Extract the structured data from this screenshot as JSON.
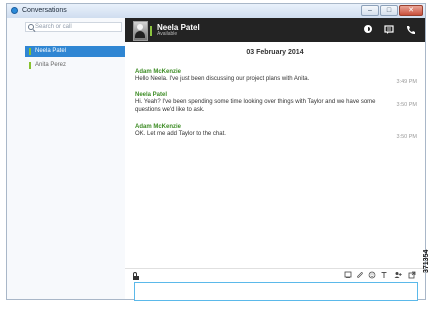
{
  "window": {
    "title": "Conversations",
    "controls": [
      "–",
      "□",
      "✕"
    ]
  },
  "sidebar": {
    "search_placeholder": "Search or call",
    "contacts": [
      {
        "name": "Neela Patel",
        "selected": true,
        "status_color": "#8cc43f"
      },
      {
        "name": "Anita Perez",
        "selected": false,
        "status_color": "#8cc43f"
      }
    ]
  },
  "header": {
    "contact_name": "Neela Patel",
    "status": "Available",
    "icons": [
      "half-circle-icon",
      "chat-icon",
      "phone-icon"
    ]
  },
  "chat": {
    "date": "03 February 2014",
    "messages": [
      {
        "sender": "Adam McKenzie",
        "text": "Hello Neela. I've just been discussing our project plans with Anita.",
        "time": "3:49 PM"
      },
      {
        "sender": "Neela Patel",
        "text": "Hi. Yeah? I've been spending some time looking over things with Taylor and we have some questions we'd like to ask.",
        "time": "3:50 PM"
      },
      {
        "sender": "Adam McKenzie",
        "text": "OK. Let me add Taylor to the chat.",
        "time": "3:50 PM"
      }
    ]
  },
  "composer": {
    "toolbar_icons": [
      "screenshot-icon",
      "attach-icon",
      "emoticon-icon",
      "font-icon",
      "add-participant-icon",
      "popout-icon"
    ],
    "input_value": ""
  },
  "figure_label": "371354",
  "colors": {
    "accent": "#2f86d3",
    "header_background": "#232323",
    "sender_green": "#3d8c25",
    "input_border": "#5bb9ea"
  }
}
